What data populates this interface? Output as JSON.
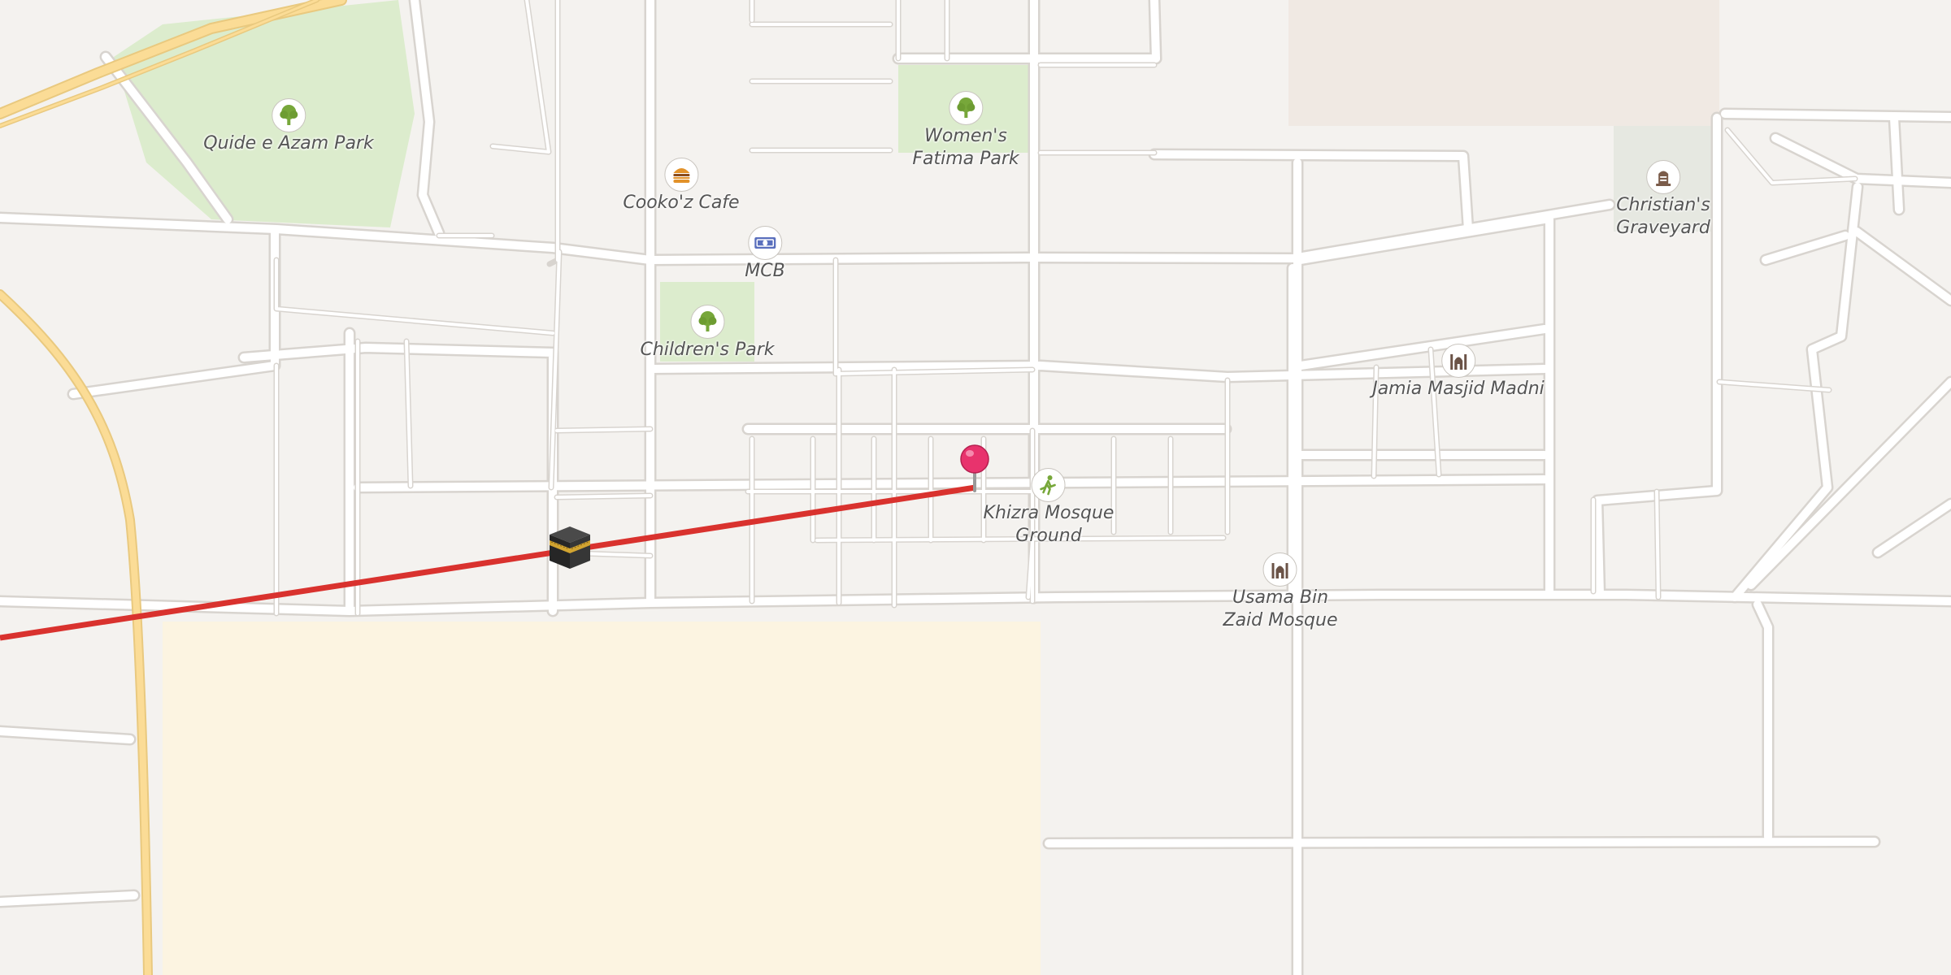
{
  "map": {
    "colors": {
      "land": "#f4f2ef",
      "road": "#ffffff",
      "road_casing": "#d8d4cf",
      "highway": "#fbdc96",
      "highway_casing": "#e9c97f",
      "park": "#dceccd",
      "sand": "#fcf4e1",
      "cemetery": "#e6e8e1",
      "qibla_line": "#d9322e",
      "pin": "#e8336d"
    },
    "poi": {
      "quaid_park": {
        "label": "Quide e Azam Park",
        "icon": "tree-icon"
      },
      "womens_park": {
        "label": "Women's\nFatima Park",
        "icon": "tree-icon"
      },
      "cookoz_cafe": {
        "label": "Cooko'z Cafe",
        "icon": "burger-icon"
      },
      "mcb": {
        "label": "MCB",
        "icon": "banknote-icon"
      },
      "childrens_park": {
        "label": "Children's Park",
        "icon": "tree-icon"
      },
      "christians_graveyard": {
        "label": "Christian's\nGraveyard",
        "icon": "gravestone-icon"
      },
      "jamia_masjid": {
        "label": "Jamia Masjid Madni",
        "icon": "mosque-icon"
      },
      "khizra_ground": {
        "label": "Khizra Mosque\nGround",
        "icon": "running-person-icon"
      },
      "usama_mosque": {
        "label": "Usama Bin\nZaid Mosque",
        "icon": "mosque-icon"
      }
    },
    "markers": {
      "kaaba": {
        "icon": "kaaba-icon"
      },
      "location_pin": {
        "icon": "map-pin-icon"
      }
    }
  }
}
